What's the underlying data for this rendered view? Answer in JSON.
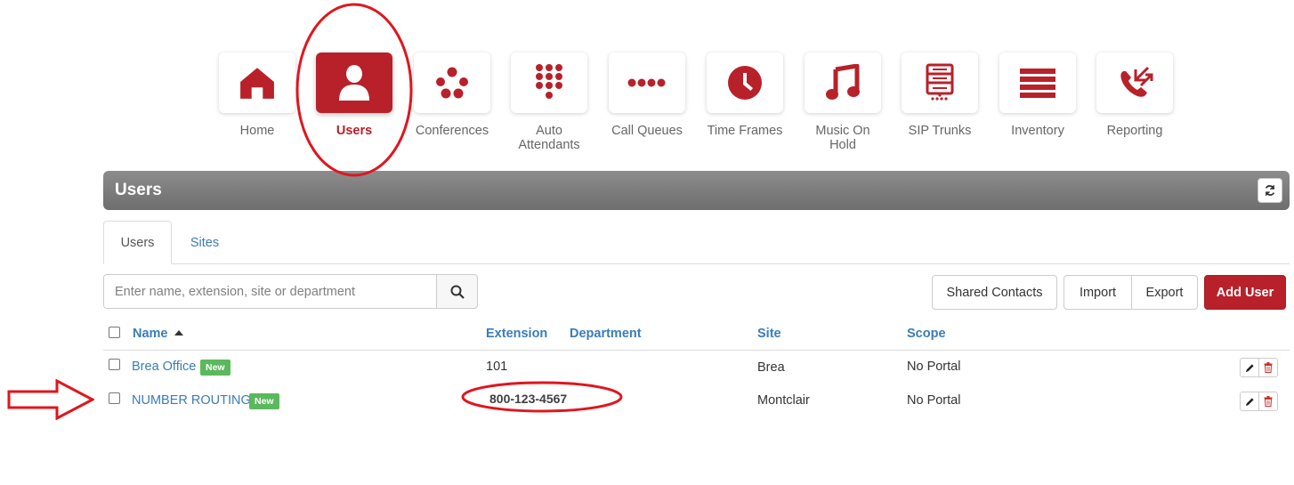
{
  "nav": {
    "items": [
      {
        "id": "home",
        "label": "Home",
        "icon": "home-icon",
        "active": false
      },
      {
        "id": "users",
        "label": "Users",
        "icon": "user-icon",
        "active": true
      },
      {
        "id": "conferences",
        "label": "Conferences",
        "icon": "conference-dots-icon",
        "active": false
      },
      {
        "id": "auto-attendants",
        "label": "Auto\nAttendants",
        "icon": "keypad-icon",
        "active": false
      },
      {
        "id": "call-queues",
        "label": "Call Queues",
        "icon": "queue-dots-icon",
        "active": false
      },
      {
        "id": "time-frames",
        "label": "Time Frames",
        "icon": "clock-icon",
        "active": false
      },
      {
        "id": "music-on-hold",
        "label": "Music On\nHold",
        "icon": "music-note-icon",
        "active": false
      },
      {
        "id": "sip-trunks",
        "label": "SIP Trunks",
        "icon": "server-icon",
        "active": false
      },
      {
        "id": "inventory",
        "label": "Inventory",
        "icon": "list-icon",
        "active": false
      },
      {
        "id": "reporting",
        "label": "Reporting",
        "icon": "phone-arrows-icon",
        "active": false
      }
    ]
  },
  "header": {
    "title": "Users",
    "refresh_icon": "refresh-icon"
  },
  "tabs": [
    {
      "label": "Users",
      "active": true
    },
    {
      "label": "Sites",
      "active": false
    }
  ],
  "search": {
    "placeholder": "Enter name, extension, site or department",
    "value": ""
  },
  "actions": {
    "shared_contacts": "Shared Contacts",
    "import": "Import",
    "export": "Export",
    "add_user": "Add User"
  },
  "table": {
    "columns": {
      "name": "Name",
      "extension": "Extension",
      "department": "Department",
      "site": "Site",
      "scope": "Scope"
    },
    "rows": [
      {
        "name": "Brea Office",
        "badge": "New",
        "extension": "101",
        "department": "",
        "site": "Brea",
        "scope": "No Portal"
      },
      {
        "name": "NUMBER ROUTING",
        "badge": "New",
        "extension": "800-123-4567",
        "department": "",
        "site": "Montclair",
        "scope": "No Portal"
      }
    ]
  },
  "colors": {
    "brand_red": "#b8212a",
    "link_blue": "#3b7cb8",
    "badge_green": "#5cb85c",
    "annotation_red": "#e0161e"
  }
}
